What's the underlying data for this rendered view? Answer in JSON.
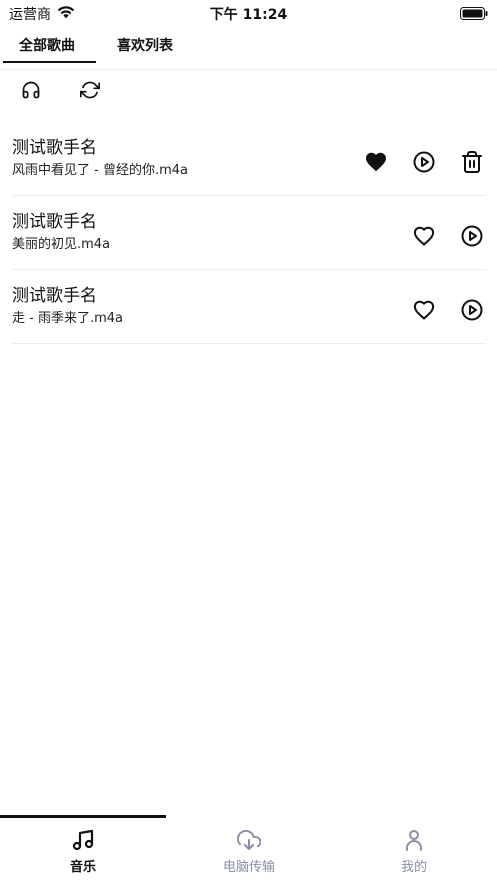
{
  "status_bar": {
    "carrier": "运营商",
    "time": "下午 11:24"
  },
  "top_tabs": [
    {
      "label": "全部歌曲",
      "active": true
    },
    {
      "label": "喜欢列表",
      "active": false
    }
  ],
  "toolbar": [
    {
      "icon": "headphones-icon"
    },
    {
      "icon": "refresh-icon"
    }
  ],
  "songs": [
    {
      "artist": "测试歌手名",
      "file": "风雨中看见了 - 曾经的你.m4a",
      "favorited": true,
      "deletable": true
    },
    {
      "artist": "测试歌手名",
      "file": "美丽的初见.m4a",
      "favorited": false,
      "deletable": false
    },
    {
      "artist": "测试歌手名",
      "file": "走 - 雨季来了.m4a",
      "favorited": false,
      "deletable": false
    }
  ],
  "bottom_nav": [
    {
      "label": "音乐",
      "icon": "music-note-icon",
      "active": true
    },
    {
      "label": "电脑传输",
      "icon": "cloud-download-icon",
      "active": false
    },
    {
      "label": "我的",
      "icon": "person-icon",
      "active": false
    }
  ],
  "colors": {
    "active": "#111111",
    "inactive": "#8a8fa3",
    "divider": "#ececec"
  }
}
